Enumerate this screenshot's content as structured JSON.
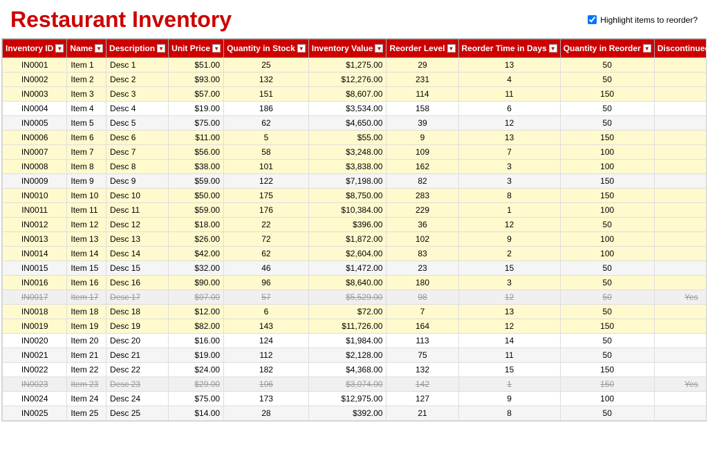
{
  "app": {
    "title": "Restaurant Inventory",
    "highlight_label": "Highlight items to reorder?"
  },
  "columns": [
    {
      "key": "id",
      "label": "Inventory ID"
    },
    {
      "key": "name",
      "label": "Name"
    },
    {
      "key": "description",
      "label": "Description"
    },
    {
      "key": "unit_price",
      "label": "Unit Price"
    },
    {
      "key": "qty_in_stock",
      "label": "Quantity in Stock"
    },
    {
      "key": "inventory_value",
      "label": "Inventory Value"
    },
    {
      "key": "reorder_level",
      "label": "Reorder Level"
    },
    {
      "key": "reorder_time_days",
      "label": "Reorder Time in Days"
    },
    {
      "key": "qty_in_reorder",
      "label": "Quantity in Reorder"
    },
    {
      "key": "discontinued",
      "label": "Discontinued?"
    }
  ],
  "rows": [
    {
      "id": "IN0001",
      "name": "Item 1",
      "description": "Desc 1",
      "unit_price": "$51.00",
      "qty_in_stock": 25,
      "inventory_value": "$1,275.00",
      "reorder_level": 29,
      "reorder_time_days": 13,
      "qty_in_reorder": 50,
      "discontinued": "",
      "needs_reorder": true
    },
    {
      "id": "IN0002",
      "name": "Item 2",
      "description": "Desc 2",
      "unit_price": "$93.00",
      "qty_in_stock": 132,
      "inventory_value": "$12,276.00",
      "reorder_level": 231,
      "reorder_time_days": 4,
      "qty_in_reorder": 50,
      "discontinued": "",
      "needs_reorder": true
    },
    {
      "id": "IN0003",
      "name": "Item 3",
      "description": "Desc 3",
      "unit_price": "$57.00",
      "qty_in_stock": 151,
      "inventory_value": "$8,607.00",
      "reorder_level": 114,
      "reorder_time_days": 11,
      "qty_in_reorder": 150,
      "discontinued": "",
      "needs_reorder": true
    },
    {
      "id": "IN0004",
      "name": "Item 4",
      "description": "Desc 4",
      "unit_price": "$19.00",
      "qty_in_stock": 186,
      "inventory_value": "$3,534.00",
      "reorder_level": 158,
      "reorder_time_days": 6,
      "qty_in_reorder": 50,
      "discontinued": "",
      "needs_reorder": false
    },
    {
      "id": "IN0005",
      "name": "Item 5",
      "description": "Desc 5",
      "unit_price": "$75.00",
      "qty_in_stock": 62,
      "inventory_value": "$4,650.00",
      "reorder_level": 39,
      "reorder_time_days": 12,
      "qty_in_reorder": 50,
      "discontinued": "",
      "needs_reorder": false
    },
    {
      "id": "IN0006",
      "name": "Item 6",
      "description": "Desc 6",
      "unit_price": "$11.00",
      "qty_in_stock": 5,
      "inventory_value": "$55.00",
      "reorder_level": 9,
      "reorder_time_days": 13,
      "qty_in_reorder": 150,
      "discontinued": "",
      "needs_reorder": true
    },
    {
      "id": "IN0007",
      "name": "Item 7",
      "description": "Desc 7",
      "unit_price": "$56.00",
      "qty_in_stock": 58,
      "inventory_value": "$3,248.00",
      "reorder_level": 109,
      "reorder_time_days": 7,
      "qty_in_reorder": 100,
      "discontinued": "",
      "needs_reorder": true
    },
    {
      "id": "IN0008",
      "name": "Item 8",
      "description": "Desc 8",
      "unit_price": "$38.00",
      "qty_in_stock": 101,
      "inventory_value": "$3,838.00",
      "reorder_level": 162,
      "reorder_time_days": 3,
      "qty_in_reorder": 100,
      "discontinued": "",
      "needs_reorder": true
    },
    {
      "id": "IN0009",
      "name": "Item 9",
      "description": "Desc 9",
      "unit_price": "$59.00",
      "qty_in_stock": 122,
      "inventory_value": "$7,198.00",
      "reorder_level": 82,
      "reorder_time_days": 3,
      "qty_in_reorder": 150,
      "discontinued": "",
      "needs_reorder": false
    },
    {
      "id": "IN0010",
      "name": "Item 10",
      "description": "Desc 10",
      "unit_price": "$50.00",
      "qty_in_stock": 175,
      "inventory_value": "$8,750.00",
      "reorder_level": 283,
      "reorder_time_days": 8,
      "qty_in_reorder": 150,
      "discontinued": "",
      "needs_reorder": true
    },
    {
      "id": "IN0011",
      "name": "Item 11",
      "description": "Desc 11",
      "unit_price": "$59.00",
      "qty_in_stock": 176,
      "inventory_value": "$10,384.00",
      "reorder_level": 229,
      "reorder_time_days": 1,
      "qty_in_reorder": 100,
      "discontinued": "",
      "needs_reorder": true
    },
    {
      "id": "IN0012",
      "name": "Item 12",
      "description": "Desc 12",
      "unit_price": "$18.00",
      "qty_in_stock": 22,
      "inventory_value": "$396.00",
      "reorder_level": 36,
      "reorder_time_days": 12,
      "qty_in_reorder": 50,
      "discontinued": "",
      "needs_reorder": true
    },
    {
      "id": "IN0013",
      "name": "Item 13",
      "description": "Desc 13",
      "unit_price": "$26.00",
      "qty_in_stock": 72,
      "inventory_value": "$1,872.00",
      "reorder_level": 102,
      "reorder_time_days": 9,
      "qty_in_reorder": 100,
      "discontinued": "",
      "needs_reorder": true
    },
    {
      "id": "IN0014",
      "name": "Item 14",
      "description": "Desc 14",
      "unit_price": "$42.00",
      "qty_in_stock": 62,
      "inventory_value": "$2,604.00",
      "reorder_level": 83,
      "reorder_time_days": 2,
      "qty_in_reorder": 100,
      "discontinued": "",
      "needs_reorder": true
    },
    {
      "id": "IN0015",
      "name": "Item 15",
      "description": "Desc 15",
      "unit_price": "$32.00",
      "qty_in_stock": 46,
      "inventory_value": "$1,472.00",
      "reorder_level": 23,
      "reorder_time_days": 15,
      "qty_in_reorder": 50,
      "discontinued": "",
      "needs_reorder": false
    },
    {
      "id": "IN0016",
      "name": "Item 16",
      "description": "Desc 16",
      "unit_price": "$90.00",
      "qty_in_stock": 96,
      "inventory_value": "$8,640.00",
      "reorder_level": 180,
      "reorder_time_days": 3,
      "qty_in_reorder": 50,
      "discontinued": "",
      "needs_reorder": true
    },
    {
      "id": "IN0017",
      "name": "Item 17",
      "description": "Desc 17",
      "unit_price": "$97.00",
      "qty_in_stock": 57,
      "inventory_value": "$5,529.00",
      "reorder_level": 98,
      "reorder_time_days": 12,
      "qty_in_reorder": 50,
      "discontinued": "Yes",
      "needs_reorder": false
    },
    {
      "id": "IN0018",
      "name": "Item 18",
      "description": "Desc 18",
      "unit_price": "$12.00",
      "qty_in_stock": 6,
      "inventory_value": "$72.00",
      "reorder_level": 7,
      "reorder_time_days": 13,
      "qty_in_reorder": 50,
      "discontinued": "",
      "needs_reorder": true
    },
    {
      "id": "IN0019",
      "name": "Item 19",
      "description": "Desc 19",
      "unit_price": "$82.00",
      "qty_in_stock": 143,
      "inventory_value": "$11,726.00",
      "reorder_level": 164,
      "reorder_time_days": 12,
      "qty_in_reorder": 150,
      "discontinued": "",
      "needs_reorder": true
    },
    {
      "id": "IN0020",
      "name": "Item 20",
      "description": "Desc 20",
      "unit_price": "$16.00",
      "qty_in_stock": 124,
      "inventory_value": "$1,984.00",
      "reorder_level": 113,
      "reorder_time_days": 14,
      "qty_in_reorder": 50,
      "discontinued": "",
      "needs_reorder": false
    },
    {
      "id": "IN0021",
      "name": "Item 21",
      "description": "Desc 21",
      "unit_price": "$19.00",
      "qty_in_stock": 112,
      "inventory_value": "$2,128.00",
      "reorder_level": 75,
      "reorder_time_days": 11,
      "qty_in_reorder": 50,
      "discontinued": "",
      "needs_reorder": false
    },
    {
      "id": "IN0022",
      "name": "Item 22",
      "description": "Desc 22",
      "unit_price": "$24.00",
      "qty_in_stock": 182,
      "inventory_value": "$4,368.00",
      "reorder_level": 132,
      "reorder_time_days": 15,
      "qty_in_reorder": 150,
      "discontinued": "",
      "needs_reorder": false
    },
    {
      "id": "IN0023",
      "name": "Item 23",
      "description": "Desc 23",
      "unit_price": "$29.00",
      "qty_in_stock": 106,
      "inventory_value": "$3,074.00",
      "reorder_level": 142,
      "reorder_time_days": 1,
      "qty_in_reorder": 150,
      "discontinued": "Yes",
      "needs_reorder": false
    },
    {
      "id": "IN0024",
      "name": "Item 24",
      "description": "Desc 24",
      "unit_price": "$75.00",
      "qty_in_stock": 173,
      "inventory_value": "$12,975.00",
      "reorder_level": 127,
      "reorder_time_days": 9,
      "qty_in_reorder": 100,
      "discontinued": "",
      "needs_reorder": false
    },
    {
      "id": "IN0025",
      "name": "Item 25",
      "description": "Desc 25",
      "unit_price": "$14.00",
      "qty_in_stock": 28,
      "inventory_value": "$392.00",
      "reorder_level": 21,
      "reorder_time_days": 8,
      "qty_in_reorder": 50,
      "discontinued": "",
      "needs_reorder": false
    }
  ]
}
